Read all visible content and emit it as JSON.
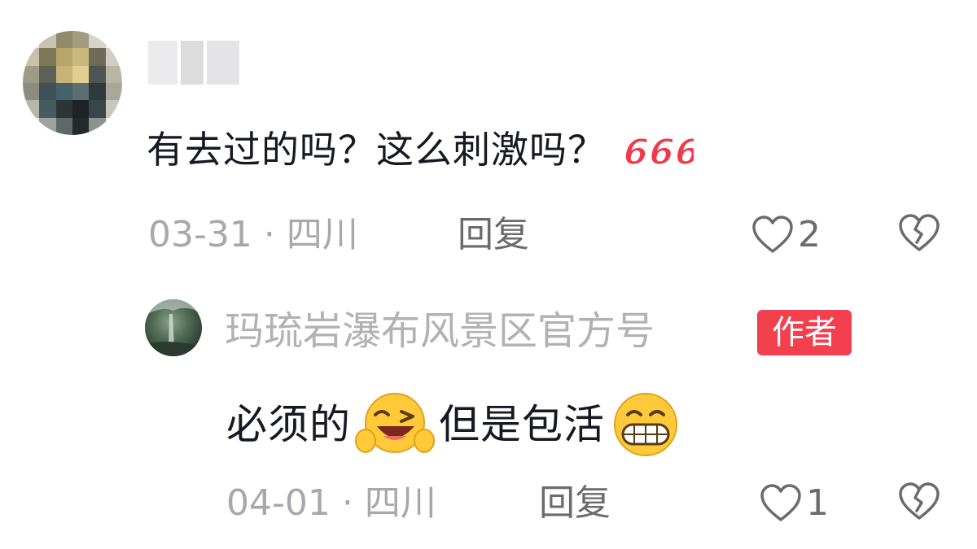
{
  "comment": {
    "username": "",
    "text": "有去过的吗？这么刺激吗？",
    "sticker_text": "666",
    "date": "03-31",
    "separator": "·",
    "location": "四川",
    "reply_label": "回复",
    "like_count": "2",
    "icons": {
      "like": "heart-outline-icon",
      "dislike": "broken-heart-icon"
    }
  },
  "reply": {
    "author_name": "玛琉岩瀑布风景区官方号",
    "badge_label": "作者",
    "text_part1": "必须的",
    "text_part2": "但是包活",
    "emoji1": "laughing-wink-emoji",
    "emoji2": "grinning-teeth-emoji",
    "date": "04-01",
    "separator": "·",
    "location": "四川",
    "reply_label": "回复",
    "like_count": "1",
    "icons": {
      "like": "heart-outline-icon",
      "dislike": "broken-heart-icon"
    }
  },
  "colors": {
    "badge": "#f2404f",
    "meta_text": "#a8a8ac",
    "name_text": "#b2b2b6"
  }
}
